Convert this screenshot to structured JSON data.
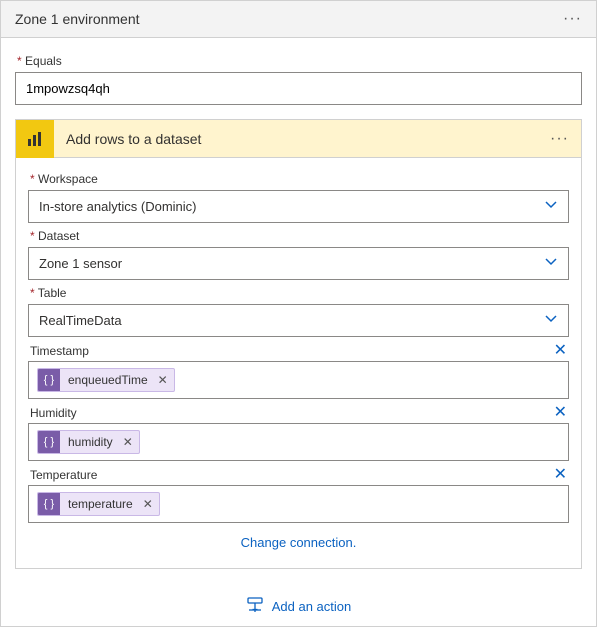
{
  "header": {
    "title": "Zone 1 environment"
  },
  "equals": {
    "label": "Equals",
    "value": "1mpowzsq4qh"
  },
  "action": {
    "title": "Add rows to a dataset",
    "fields": {
      "workspace": {
        "label": "Workspace",
        "value": "In-store analytics (Dominic)"
      },
      "dataset": {
        "label": "Dataset",
        "value": "Zone 1 sensor"
      },
      "table": {
        "label": "Table",
        "value": "RealTimeData"
      },
      "timestamp": {
        "label": "Timestamp",
        "token": "enqueuedTime"
      },
      "humidity": {
        "label": "Humidity",
        "token": "humidity"
      },
      "temperature": {
        "label": "Temperature",
        "token": "temperature"
      }
    },
    "change_connection": "Change connection."
  },
  "footer": {
    "add_action": "Add an action"
  }
}
